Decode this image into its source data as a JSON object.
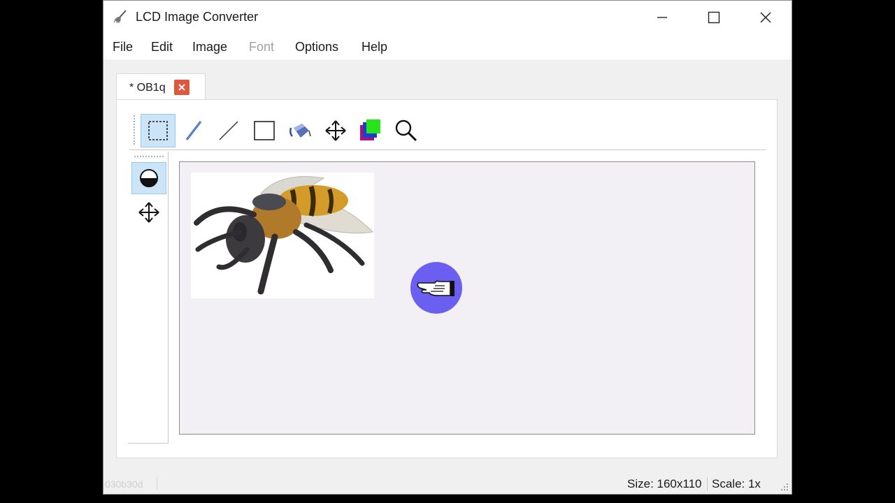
{
  "window": {
    "title": "LCD Image Converter",
    "icon": "broom-icon",
    "controls": {
      "minimize": "minimize-icon",
      "maximize": "maximize-icon",
      "close": "close-icon"
    }
  },
  "menu": [
    {
      "label": "File",
      "enabled": true
    },
    {
      "label": "Edit",
      "enabled": true
    },
    {
      "label": "Image",
      "enabled": true
    },
    {
      "label": "Font",
      "enabled": false
    },
    {
      "label": "Options",
      "enabled": true
    },
    {
      "label": "Help",
      "enabled": true
    }
  ],
  "tab": {
    "label": "* OB1q",
    "close_icon": "close-icon"
  },
  "toolbar": [
    {
      "icon": "select-rectangle-icon",
      "active": true
    },
    {
      "icon": "pen-icon",
      "active": false
    },
    {
      "icon": "line-icon",
      "active": false
    },
    {
      "icon": "rectangle-icon",
      "active": false
    },
    {
      "icon": "fill-bucket-icon",
      "active": false
    },
    {
      "icon": "move-icon",
      "active": false
    },
    {
      "icon": "color-icon",
      "active": false
    },
    {
      "icon": "zoom-icon",
      "active": false
    }
  ],
  "subtoolbar": [
    {
      "icon": "selection-mode-icon",
      "active": true
    },
    {
      "icon": "move-icon",
      "active": false
    }
  ],
  "canvas": {
    "image": "bee-photo",
    "cursor": "pointing-hand-icon"
  },
  "status": {
    "left_text": "030b30d",
    "size": "Size: 160x110",
    "scale": "Scale: 1x"
  },
  "colors": {
    "cursor_marker": "#6a5ff0",
    "tab_close": "#e0573f",
    "active_tool": "#cce4f7"
  }
}
